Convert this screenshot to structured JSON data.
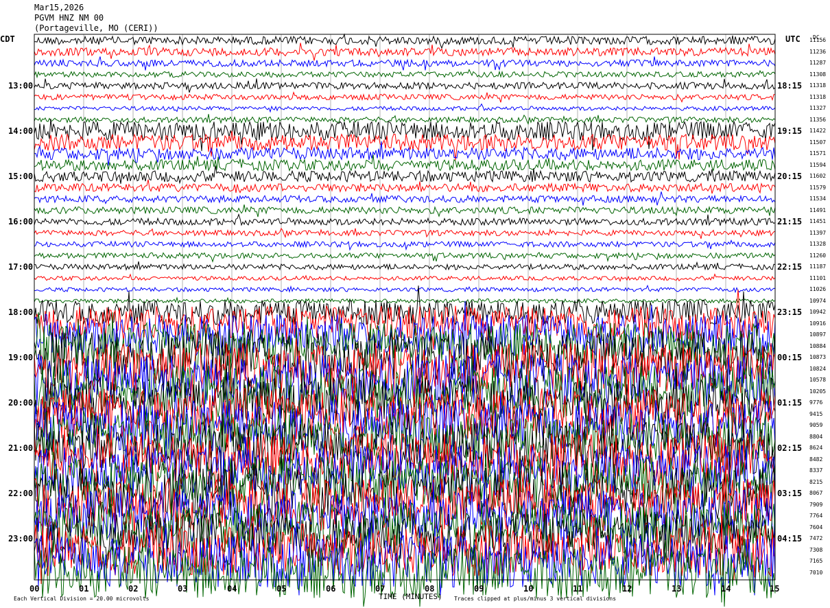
{
  "header": {
    "date": "Mar15,2026",
    "station": "PGVM HNZ NM 00",
    "location": "(Portageville, MO (CERI))"
  },
  "left_axis_label": "CDT",
  "right_axis_label": "UTC",
  "dc_label": "DC",
  "x_axis_title": "TIME (MINUTES)",
  "footer_left": "Each Vertical Division = 20.00 microvolts",
  "footer_right": "Traces clipped at plus/minus 3 vertical divisions",
  "colors": {
    "trace_cycle": [
      "#000000",
      "#ff0000",
      "#0000ff",
      "#006400"
    ],
    "grid": "#808080"
  },
  "chart_data": {
    "type": "line",
    "title": "PGVM HNZ NM 00",
    "xlabel": "TIME (MINUTES)",
    "ylabel": "",
    "xlim": [
      0,
      15
    ],
    "x_ticks": [
      "00",
      "01",
      "02",
      "03",
      "04",
      "05",
      "06",
      "07",
      "08",
      "09",
      "10",
      "11",
      "12",
      "13",
      "14",
      "15"
    ],
    "trace_count": 48,
    "traces_per_hour": 4,
    "left_hour_labels": [
      {
        "trace": 4,
        "label": "13:00"
      },
      {
        "trace": 8,
        "label": "14:00"
      },
      {
        "trace": 12,
        "label": "15:00"
      },
      {
        "trace": 16,
        "label": "16:00"
      },
      {
        "trace": 20,
        "label": "17:00"
      },
      {
        "trace": 24,
        "label": "18:00"
      },
      {
        "trace": 28,
        "label": "19:00"
      },
      {
        "trace": 32,
        "label": "20:00"
      },
      {
        "trace": 36,
        "label": "21:00"
      },
      {
        "trace": 40,
        "label": "22:00"
      },
      {
        "trace": 44,
        "label": "23:00"
      }
    ],
    "right_hour_labels": [
      {
        "trace": 4,
        "label": "18:15"
      },
      {
        "trace": 8,
        "label": "19:15"
      },
      {
        "trace": 12,
        "label": "20:15"
      },
      {
        "trace": 16,
        "label": "21:15"
      },
      {
        "trace": 20,
        "label": "22:15"
      },
      {
        "trace": 24,
        "label": "23:15"
      },
      {
        "trace": 28,
        "label": "00:15"
      },
      {
        "trace": 32,
        "label": "01:15"
      },
      {
        "trace": 36,
        "label": "02:15"
      },
      {
        "trace": 40,
        "label": "03:15"
      },
      {
        "trace": 44,
        "label": "04:15"
      }
    ],
    "dc_offsets": [
      11156,
      11236,
      11287,
      11308,
      11318,
      11318,
      11327,
      11356,
      11422,
      11507,
      11571,
      11594,
      11602,
      11579,
      11534,
      11491,
      11451,
      11397,
      11328,
      11260,
      11187,
      11101,
      11026,
      10974,
      10942,
      10916,
      10897,
      10884,
      10873,
      10824,
      10578,
      10205,
      9776,
      9415,
      9059,
      8804,
      8624,
      8482,
      8337,
      8215,
      8067,
      7909,
      7764,
      7604,
      7472,
      7308,
      7165,
      7010
    ],
    "noise_amplitude": [
      6,
      6,
      5,
      4,
      5,
      4,
      3,
      4,
      14,
      12,
      9,
      8,
      8,
      6,
      5,
      5,
      5,
      4,
      4,
      4,
      4,
      3,
      3,
      3,
      18,
      26,
      30,
      34,
      38,
      38,
      38,
      38,
      38,
      38,
      38,
      38,
      38,
      38,
      38,
      38,
      38,
      38,
      38,
      38,
      38,
      38,
      38,
      38
    ],
    "clip_divisions": 3
  }
}
